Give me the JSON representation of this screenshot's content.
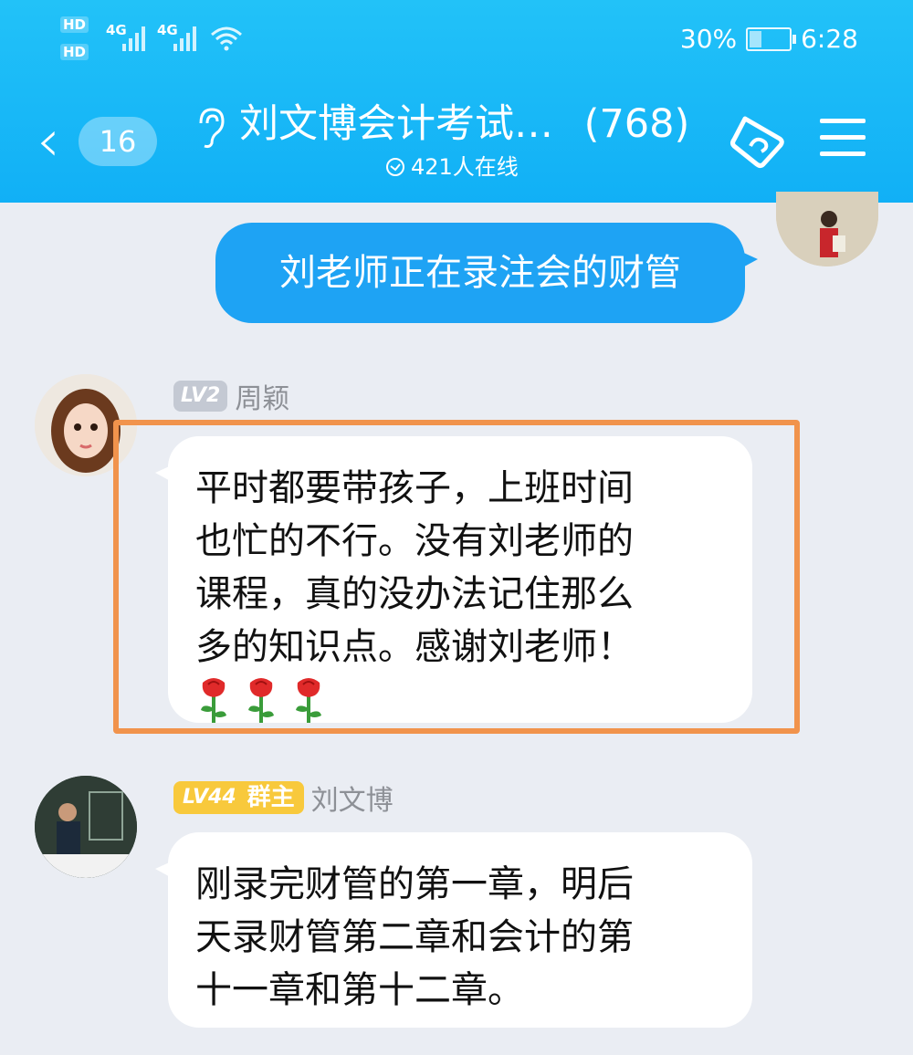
{
  "status_bar": {
    "hd1": "HD",
    "hd2": "HD",
    "net1": "4G",
    "net2": "4G",
    "battery_percent": "30%",
    "battery_level": 0.3,
    "time": "6:28"
  },
  "header": {
    "unread_count": "16",
    "group_title": "刘文博会计考试…",
    "member_count": "(768)",
    "online": "421人在线"
  },
  "messages": [
    {
      "type": "outgoing",
      "text": "刘老师正在录注会的财管"
    },
    {
      "type": "incoming",
      "level": "LV2",
      "sender": "周颖",
      "lines": [
        "平时都要带孩子，上班时间",
        "也忙的不行。没有刘老师的",
        "课程，真的没办法记住那么",
        "多的知识点。感谢刘老师！"
      ],
      "emoji": [
        "rose-icon",
        "rose-icon",
        "rose-icon"
      ]
    },
    {
      "type": "incoming",
      "level": "LV44",
      "role": "群主",
      "sender": "刘文博",
      "lines": [
        "刚录完财管的第一章，明后",
        "天录财管第二章和会计的第",
        "十一章和第十二章。"
      ]
    }
  ],
  "colors": {
    "header": "#1db8f7",
    "outgoing_bubble": "#1ea3f4",
    "highlight_frame": "#f1934c",
    "owner_badge": "#f8c93c"
  }
}
